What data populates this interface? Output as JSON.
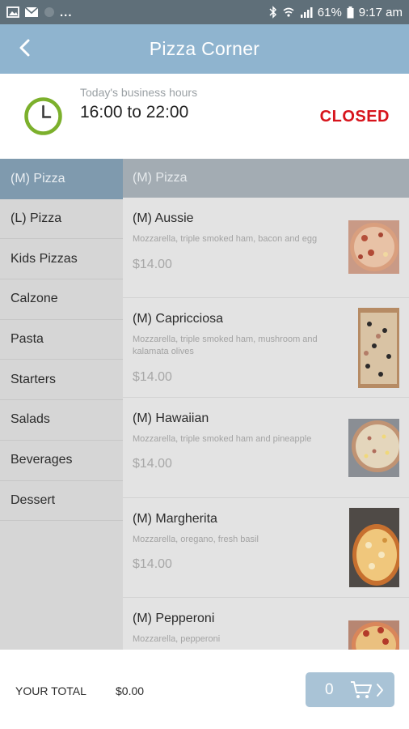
{
  "status_bar": {
    "dots": "...",
    "battery": "61%",
    "time": "9:17 am",
    "icons": [
      "picture-icon",
      "mail-icon",
      "app-icon",
      "bluetooth-icon",
      "wifi-icon",
      "signal-icon",
      "battery-icon"
    ]
  },
  "header": {
    "title": "Pizza Corner",
    "back_icon": "back-arrow-icon",
    "background": "#8fb4cf"
  },
  "hours": {
    "label": "Today's business hours",
    "value": "16:00 to 22:00",
    "status": "CLOSED",
    "status_color": "#d7141c",
    "clock_color": "#7cb02c"
  },
  "categories": [
    {
      "label": "(M) Pizza",
      "active": true
    },
    {
      "label": "(L) Pizza",
      "active": false
    },
    {
      "label": "Kids Pizzas",
      "active": false
    },
    {
      "label": "Calzone",
      "active": false
    },
    {
      "label": "Pasta",
      "active": false
    },
    {
      "label": "Starters",
      "active": false
    },
    {
      "label": "Salads",
      "active": false
    },
    {
      "label": "Beverages",
      "active": false
    },
    {
      "label": "Dessert",
      "active": false
    }
  ],
  "list": {
    "header": "(M) Pizza",
    "items": [
      {
        "name": "(M) Aussie",
        "description": "Mozzarella, triple smoked ham, bacon and egg",
        "price": "$14.00"
      },
      {
        "name": "(M) Capricciosa",
        "description": "Mozzarella, triple smoked ham, mushroom and kalamata olives",
        "price": "$14.00"
      },
      {
        "name": "(M) Hawaiian",
        "description": "Mozzarella, triple smoked ham and pineapple",
        "price": "$14.00"
      },
      {
        "name": "(M) Margherita",
        "description": "Mozzarella, oregano, fresh basil",
        "price": "$14.00"
      },
      {
        "name": "(M) Pepperoni",
        "description": "Mozzarella, pepperoni",
        "price": ""
      }
    ]
  },
  "footer": {
    "total_label": "YOUR TOTAL",
    "total_value": "$0.00",
    "cart_count": "0",
    "cart_icon": "cart-icon",
    "chevron_icon": "chevron-right-icon"
  }
}
